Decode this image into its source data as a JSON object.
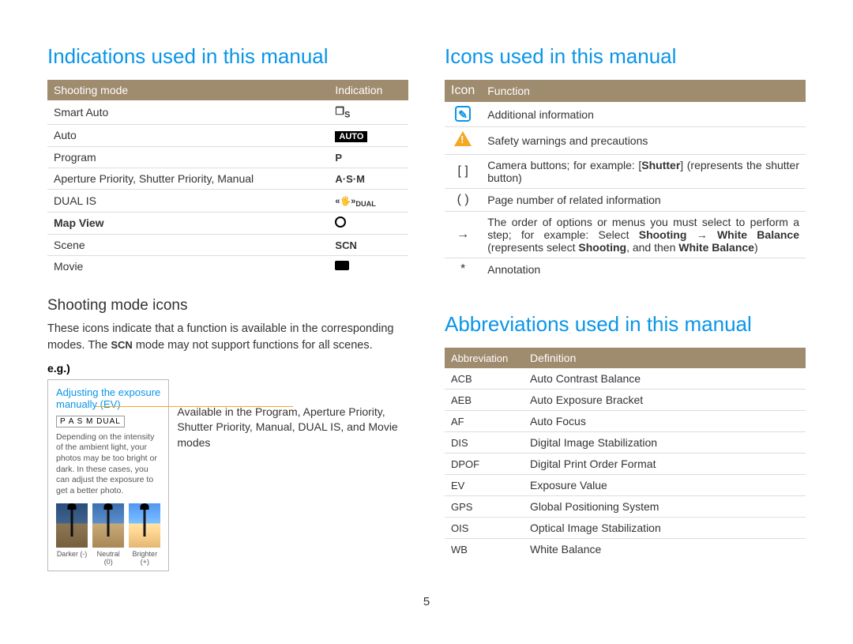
{
  "page_number": "5",
  "left": {
    "title": "Indications used in this manual",
    "table_headers": [
      "Shooting mode",
      "Indication"
    ],
    "table": [
      {
        "mode": "Smart Auto",
        "ind_text": "S",
        "kind": "smart"
      },
      {
        "mode": "Auto",
        "ind_text": "AUTO",
        "kind": "auto"
      },
      {
        "mode": "Program",
        "ind_text": "P",
        "kind": "plain"
      },
      {
        "mode": "Aperture Priority, Shutter Priority, Manual",
        "ind_text": "A·S·M",
        "kind": "plain"
      },
      {
        "mode": "DUAL IS",
        "ind_text": "DUAL",
        "kind": "dual"
      },
      {
        "mode": "Map View",
        "ind_text": "",
        "kind": "gps",
        "mode_bold": true
      },
      {
        "mode": "Scene",
        "ind_text": "SCN",
        "kind": "plain"
      },
      {
        "mode": "Movie",
        "ind_text": "",
        "kind": "movie"
      }
    ],
    "subheading": "Shooting mode icons",
    "desc_pre": "These icons indicate that a function is available in the corresponding modes. The ",
    "desc_scn": "SCN",
    "desc_post": " mode may not support functions for all scenes.",
    "eg_label": "e.g.)",
    "example": {
      "title": "Adjusting the exposure manually (EV)",
      "mode_strip": "P A S M DUAL",
      "body": "Depending on the intensity of the ambient light, your photos may be too bright or dark. In these cases, you can adjust the exposure to get a better photo.",
      "thumbs": [
        {
          "label": "Darker (-)",
          "cls": "darker"
        },
        {
          "label": "Neutral (0)",
          "cls": "neutral"
        },
        {
          "label": "Brighter (+)",
          "cls": "brighter"
        }
      ]
    },
    "avail_text": "Available in the Program, Aperture Priority, Shutter Priority, Manual, DUAL IS, and Movie modes"
  },
  "right": {
    "icons_title": "Icons used in this manual",
    "icons_headers": [
      "Icon",
      "Function"
    ],
    "icons": [
      {
        "kind": "info",
        "text": "Additional information"
      },
      {
        "kind": "warn",
        "text": "Safety warnings and precautions"
      },
      {
        "kind": "bracket",
        "symbol": "[  ]",
        "html": "Camera buttons; for example: [<b>Shutter</b>] (represents the shutter button)"
      },
      {
        "kind": "paren",
        "symbol": "(  )",
        "text": "Page number of related information"
      },
      {
        "kind": "arrow",
        "symbol": "→",
        "html": "The order of options or menus you must select to perform a step; for example: Select <b>Shooting</b> → <b>White Balance</b> (represents select <b>Shooting</b>, and then <b>White Balance</b>)"
      },
      {
        "kind": "star",
        "symbol": "*",
        "text": "Annotation"
      }
    ],
    "abbr_title": "Abbreviations used in this manual",
    "abbr_headers": [
      "Abbreviation",
      "Definition"
    ],
    "abbr": [
      {
        "a": "ACB",
        "d": "Auto Contrast Balance"
      },
      {
        "a": "AEB",
        "d": "Auto Exposure Bracket"
      },
      {
        "a": "AF",
        "d": "Auto Focus"
      },
      {
        "a": "DIS",
        "d": "Digital Image Stabilization"
      },
      {
        "a": "DPOF",
        "d": "Digital Print Order Format"
      },
      {
        "a": "EV",
        "d": "Exposure Value"
      },
      {
        "a": "GPS",
        "d": "Global Positioning System"
      },
      {
        "a": "OIS",
        "d": "Optical Image Stabilization"
      },
      {
        "a": "WB",
        "d": "White Balance"
      }
    ]
  }
}
